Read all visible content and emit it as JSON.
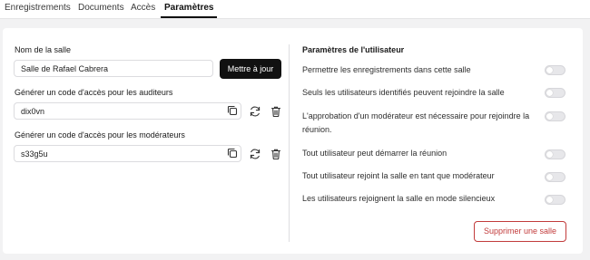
{
  "tabs": [
    {
      "label": "Enregistrements"
    },
    {
      "label": "Documents"
    },
    {
      "label": "Accès"
    },
    {
      "label": "Paramètres"
    }
  ],
  "room": {
    "name_label": "Nom de la salle",
    "name_value": "Salle de Rafael Cabrera",
    "update_button": "Mettre à jour",
    "viewer_code_label": "Générer un code d'accès pour les auditeurs",
    "viewer_code": "dix0vn",
    "moderator_code_label": "Générer un code d'accès pour les modérateurs",
    "moderator_code": "s33g5u"
  },
  "user_settings": {
    "title": "Paramètres de l'utilisateur",
    "items": [
      {
        "label": "Permettre les enregistrements dans cette salle",
        "enabled": false
      },
      {
        "label": "Seuls les utilisateurs identifiés peuvent rejoindre la salle",
        "enabled": false
      },
      {
        "label": "L'approbation d'un modérateur est nécessaire pour rejoindre la réunion.",
        "enabled": false
      },
      {
        "label": "Tout utilisateur peut démarrer la réunion",
        "enabled": false
      },
      {
        "label": "Tout utilisateur rejoint la salle en tant que modérateur",
        "enabled": false
      },
      {
        "label": "Les utilisateurs rejoignent la salle en mode silencieux",
        "enabled": false
      }
    ],
    "delete_button": "Supprimer une salle"
  },
  "icons": {
    "copy": "copy-icon",
    "regenerate": "refresh-icon",
    "delete": "trash-icon"
  },
  "colors": {
    "primary_button": "#111111",
    "danger": "#c23b3b",
    "toggle_off": "#e7e7ea"
  }
}
